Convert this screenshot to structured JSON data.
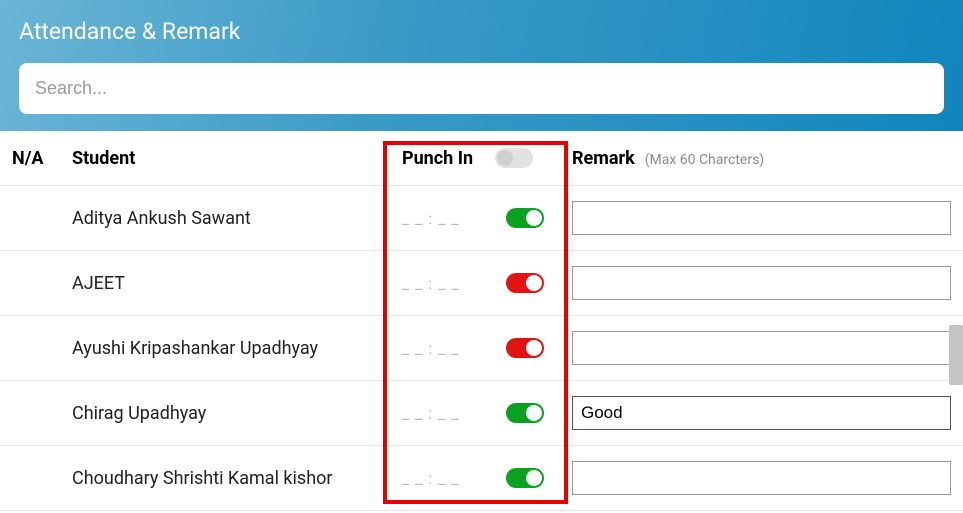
{
  "header": {
    "title": "Attendance & Remark",
    "search_placeholder": "Search..."
  },
  "columns": {
    "na": "N/A",
    "student": "Student",
    "punch_in": "Punch In",
    "remark": "Remark",
    "remark_hint": "(Max 60 Charcters)"
  },
  "header_toggle": {
    "state": "off-grey"
  },
  "punch_placeholder": "_ _ : _ _",
  "students": [
    {
      "name": "Aditya Ankush Sawant",
      "na_on": true,
      "punch_status": "on-green",
      "remark": ""
    },
    {
      "name": "AJEET",
      "na_on": true,
      "punch_status": "on-red",
      "remark": ""
    },
    {
      "name": "Ayushi Kripashankar Upadhyay",
      "na_on": true,
      "punch_status": "on-red",
      "remark": ""
    },
    {
      "name": "Chirag Upadhyay",
      "na_on": true,
      "punch_status": "on-green",
      "remark": "Good"
    },
    {
      "name": "Choudhary Shrishti Kamal kishor",
      "na_on": true,
      "punch_status": "on-green",
      "remark": ""
    }
  ]
}
